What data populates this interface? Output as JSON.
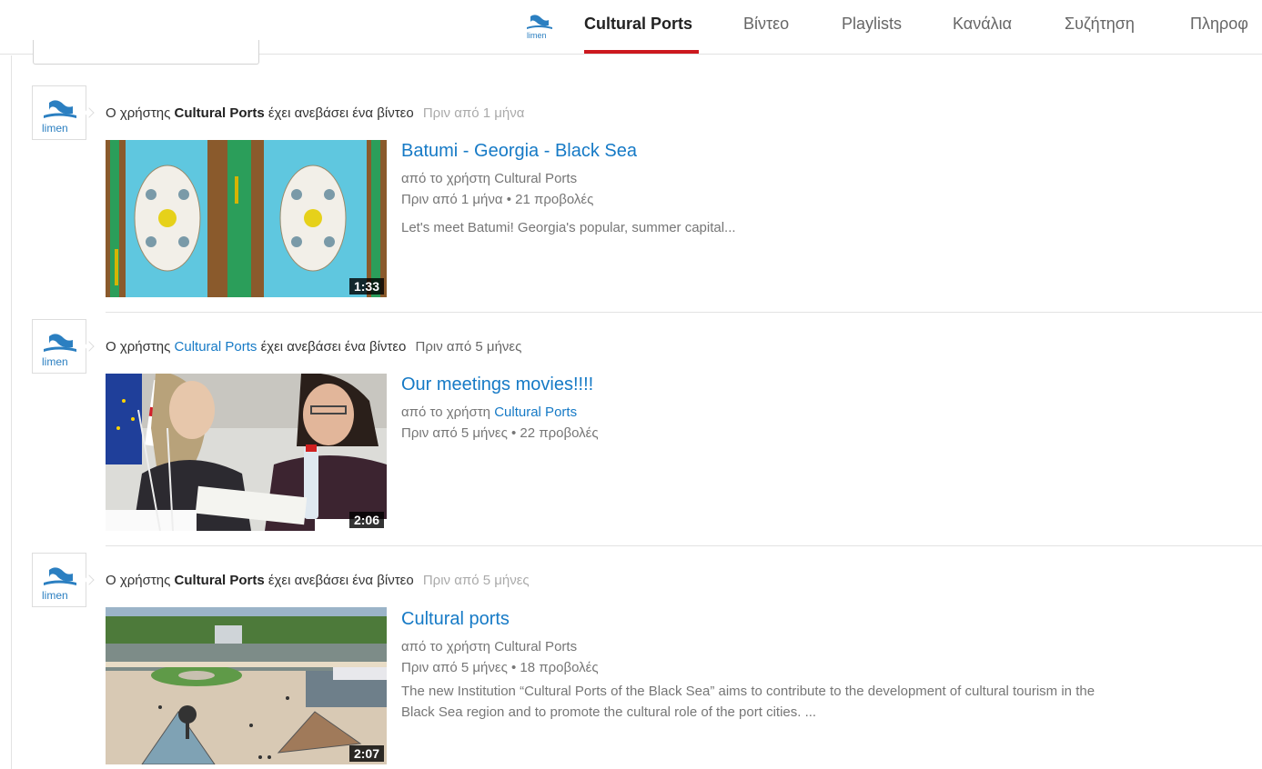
{
  "nav": {
    "logo_icon": "limen-logo-icon",
    "tabs": [
      {
        "label": "Cultural Ports",
        "active": true
      },
      {
        "label": "Βίντεο",
        "active": false
      },
      {
        "label": "Playlists",
        "active": false
      },
      {
        "label": "Κανάλια",
        "active": false
      },
      {
        "label": "Συζήτηση",
        "active": false
      },
      {
        "label": "Πληροφ",
        "active": false
      }
    ]
  },
  "feed": [
    {
      "avatar_icon": "limen-avatar-icon",
      "activity_prefix": "Ο χρήστης",
      "activity_user": "Cultural Ports",
      "activity_suffix": "έχει ανεβάσει ένα βίντεο",
      "activity_time": "Πριν από 1 μήνα",
      "title": "Batumi - Georgia - Black Sea",
      "by_prefix": "από το χρήστη",
      "channel": "Cultural Ports",
      "age": "Πριν από 1 μήνα",
      "views": "21 προβολές",
      "separator": "•",
      "description": "Let's meet Batumi! Georgia's popular, summer capital...",
      "duration": "1:33"
    },
    {
      "avatar_icon": "limen-avatar-icon",
      "activity_prefix": "Ο χρήστης",
      "activity_user": "Cultural Ports",
      "activity_suffix": "έχει ανεβάσει ένα βίντεο",
      "activity_time": "Πριν από 5 μήνες",
      "title": "Our meetings movies!!!!",
      "by_prefix": "από το χρήστη",
      "channel": "Cultural Ports",
      "age": "Πριν από 5 μήνες",
      "views": "22 προβολές",
      "separator": "•",
      "description": "",
      "duration": "2:06"
    },
    {
      "avatar_icon": "limen-avatar-icon",
      "activity_prefix": "Ο χρήστης",
      "activity_user": "Cultural Ports",
      "activity_suffix": "έχει ανεβάσει ένα βίντεο",
      "activity_time": "Πριν από 5 μήνες",
      "title": "Cultural ports",
      "by_prefix": "από το χρήστη",
      "channel": "Cultural Ports",
      "age": "Πριν από 5 μήνες",
      "views": "18 προβολές",
      "separator": "•",
      "description": "The new Institution “Cultural Ports of the Black Sea” aims to contribute to the development of cultural tourism in the Black Sea region and to promote the cultural role of the port cities. ...",
      "duration": "2:07"
    }
  ],
  "colors": {
    "link": "#167ac6",
    "accent": "#cc181e",
    "muted": "#767676"
  }
}
